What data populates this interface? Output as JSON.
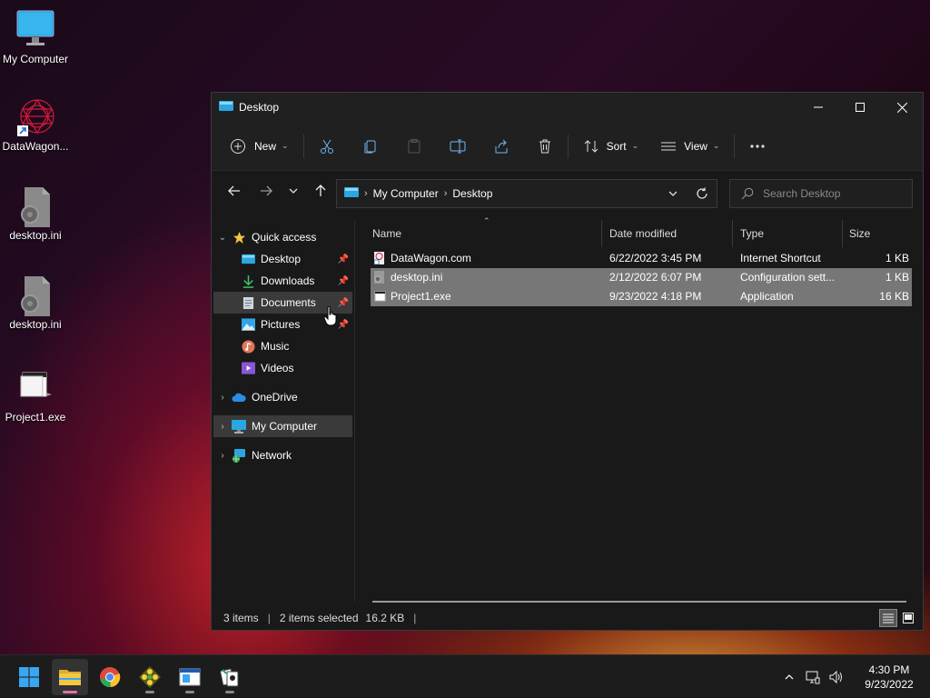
{
  "desktop": {
    "icons": [
      {
        "label": "My Computer",
        "icon": "monitor-icon"
      },
      {
        "label": "DataWagon...",
        "icon": "datawagon-shortcut-icon"
      },
      {
        "label": "desktop.ini",
        "icon": "config-file-icon"
      },
      {
        "label": "desktop.ini",
        "icon": "config-file-icon"
      },
      {
        "label": "Project1.exe",
        "icon": "application-icon"
      }
    ]
  },
  "window": {
    "title": "Desktop",
    "toolbar": {
      "new_label": "New",
      "sort_label": "Sort",
      "view_label": "View"
    },
    "address": {
      "crumbs": [
        "My Computer",
        "Desktop"
      ]
    },
    "search": {
      "placeholder": "Search Desktop"
    },
    "sidebar": {
      "quick_access": "Quick access",
      "items": [
        {
          "label": "Desktop",
          "pinned": true
        },
        {
          "label": "Downloads",
          "pinned": true
        },
        {
          "label": "Documents",
          "pinned": true
        },
        {
          "label": "Pictures",
          "pinned": true
        },
        {
          "label": "Music",
          "pinned": false
        },
        {
          "label": "Videos",
          "pinned": false
        }
      ],
      "onedrive": "OneDrive",
      "my_computer": "My Computer",
      "network": "Network"
    },
    "columns": {
      "name": "Name",
      "date": "Date modified",
      "type": "Type",
      "size": "Size"
    },
    "files": [
      {
        "name": "DataWagon.com",
        "date": "6/22/2022 3:45 PM",
        "type": "Internet Shortcut",
        "size": "1 KB",
        "selected": false
      },
      {
        "name": "desktop.ini",
        "date": "2/12/2022 6:07 PM",
        "type": "Configuration sett...",
        "size": "1 KB",
        "selected": true
      },
      {
        "name": "Project1.exe",
        "date": "9/23/2022 4:18 PM",
        "type": "Application",
        "size": "16 KB",
        "selected": true
      }
    ],
    "status": {
      "items": "3 items",
      "selected": "2 items selected",
      "size": "16.2 KB"
    }
  },
  "taskbar": {
    "time": "4:30 PM",
    "date": "9/23/2022"
  },
  "colors": {
    "accent_folder": "#f2c744",
    "selection": "#777777",
    "window_bg": "#191919"
  }
}
